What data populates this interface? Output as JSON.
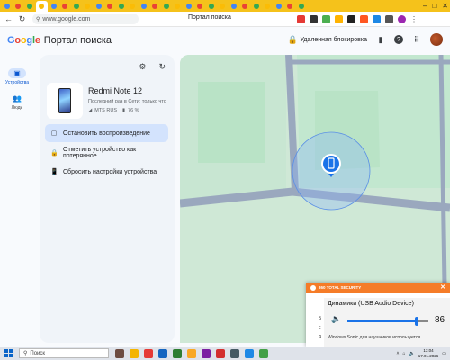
{
  "browser": {
    "url": "www.google.com",
    "tab_title": "Портал поиска",
    "tab_favicons": [
      "#4285f4",
      "#ea4335",
      "#34a853",
      "#fbbc05",
      "#4285f4",
      "#ea4335",
      "#34a853",
      "#fbbc05",
      "#4285f4",
      "#ea4335",
      "#34a853",
      "#fbbc05",
      "#4285f4",
      "#ea4335",
      "#34a853",
      "#fbbc05",
      "#4285f4",
      "#ea4335",
      "#34a853",
      "#fbbc05",
      "#4285f4",
      "#ea4335",
      "#34a853",
      "#fbbc05",
      "#4285f4",
      "#ea4335",
      "#34a853"
    ]
  },
  "app": {
    "brand": [
      "G",
      "o",
      "o",
      "g",
      "l",
      "e"
    ],
    "title": "Портал поиска",
    "remote_lock_label": "Удаленная блокировка"
  },
  "rail": {
    "devices_label": "Устройства",
    "people_label": "Люди"
  },
  "device": {
    "name": "Redmi Note 12",
    "last_seen": "Последний раз в Сети: только что",
    "carrier": "MTS RUS",
    "battery": "76 %"
  },
  "actions": {
    "stop_sound": "Остановить воспроизведение",
    "mark_lost": "Отметить устройство как потерянное",
    "reset": "Сбросить настройки устройства"
  },
  "notification": {
    "app_name": "360 TOTAL SECURITY",
    "side_b": "Б",
    "side_c": "с",
    "side_d": "д",
    "device_label": "Динамики (USB Audio Device)",
    "volume": "86",
    "volume_fraction": 0.86,
    "subtitle": "Windows Sonic для наушников используется"
  },
  "taskbar": {
    "search_placeholder": "Поиск",
    "time": "13:04",
    "date": "17.01.2026"
  },
  "colors": {
    "map_green": "#cfe8d6",
    "map_park": "#b9e3c6",
    "road": "#9aa8be",
    "accuracy": "#8ab4f8",
    "marker": "#1a73e8",
    "accent": "#0b57d0"
  }
}
